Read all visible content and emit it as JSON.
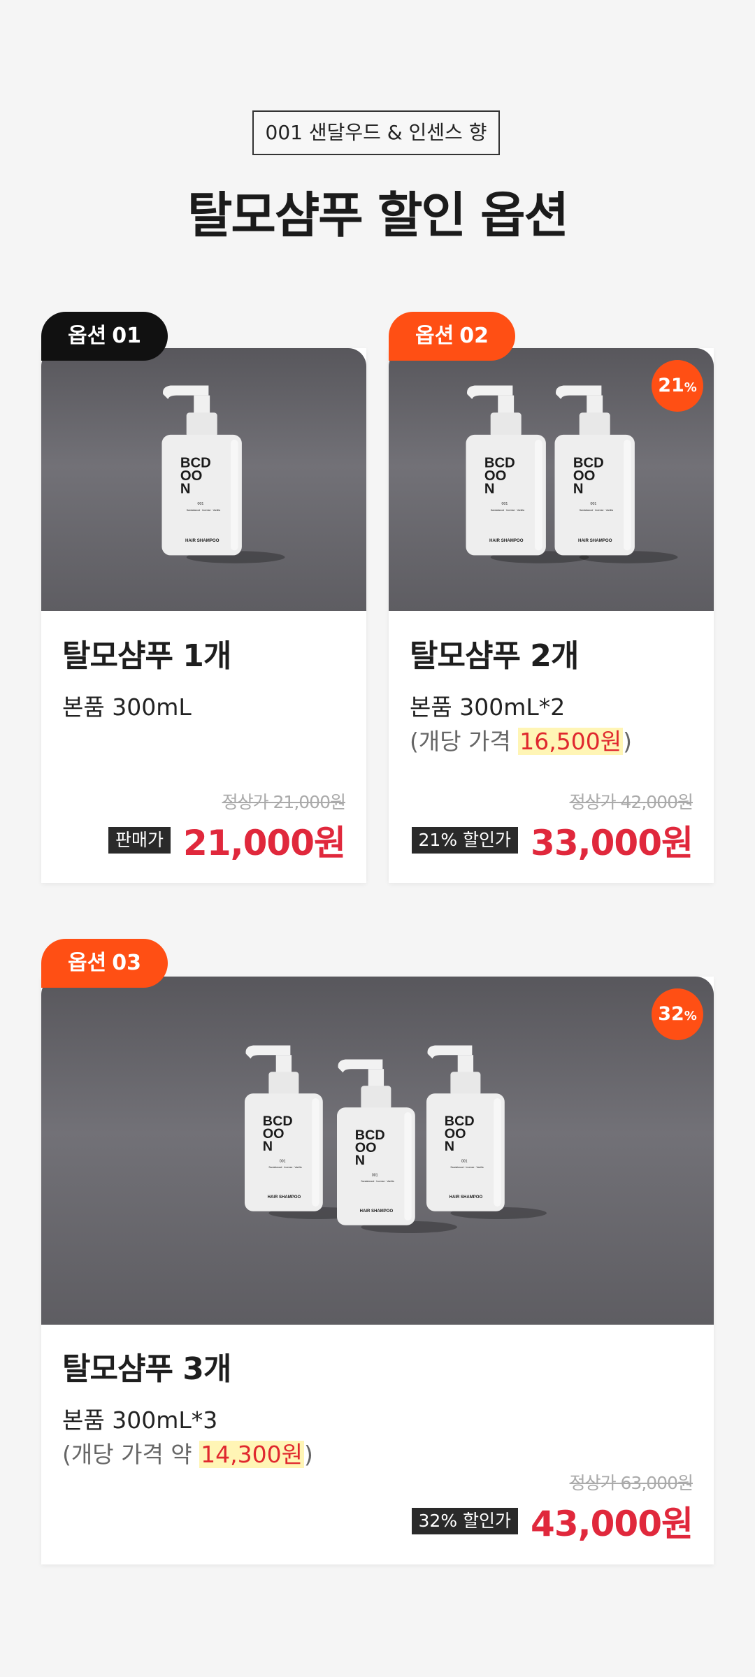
{
  "header": {
    "scent_tag": "001 샌달우드 & 인센스 향",
    "title": "탈모샴푸 할인 옵션"
  },
  "bottle": {
    "brand_line1": "BCD",
    "brand_line2": "OO",
    "brand_line3": "N",
    "code": "001",
    "notes": "Sandalwood · Incense · Vanilla",
    "label": "HAIR SHAMPOO"
  },
  "options": [
    {
      "tab_word": "옵션",
      "tab_num": "01",
      "name": "탈모샴푸 1개",
      "spec": "본품 300mL",
      "regular_price": "정상가 21,000원",
      "sale_label": "판매가",
      "sale_price": "21,000원"
    },
    {
      "tab_word": "옵션",
      "tab_num": "02",
      "discount_num": "21",
      "discount_pct": "%",
      "name": "탈모샴푸 2개",
      "spec": "본품 300mL*2",
      "unit_prefix": "(개당 가격 ",
      "unit_price": "16,500원",
      "unit_suffix": ")",
      "regular_price": "정상가 42,000원",
      "sale_label": "21% 할인가",
      "sale_price": "33,000원"
    },
    {
      "tab_word": "옵션",
      "tab_num": "03",
      "discount_num": "32",
      "discount_pct": "%",
      "name": "탈모샴푸 3개",
      "spec": "본품 300mL*3",
      "unit_prefix": "(개당 가격 약 ",
      "unit_price": "14,300원",
      "unit_suffix": ")",
      "regular_price": "정상가 63,000원",
      "sale_label": "32% 할인가",
      "sale_price": "43,000원"
    }
  ],
  "colors": {
    "accent_orange": "#ff4f14",
    "price_red": "#e0283c",
    "highlight": "#fff5b5"
  }
}
